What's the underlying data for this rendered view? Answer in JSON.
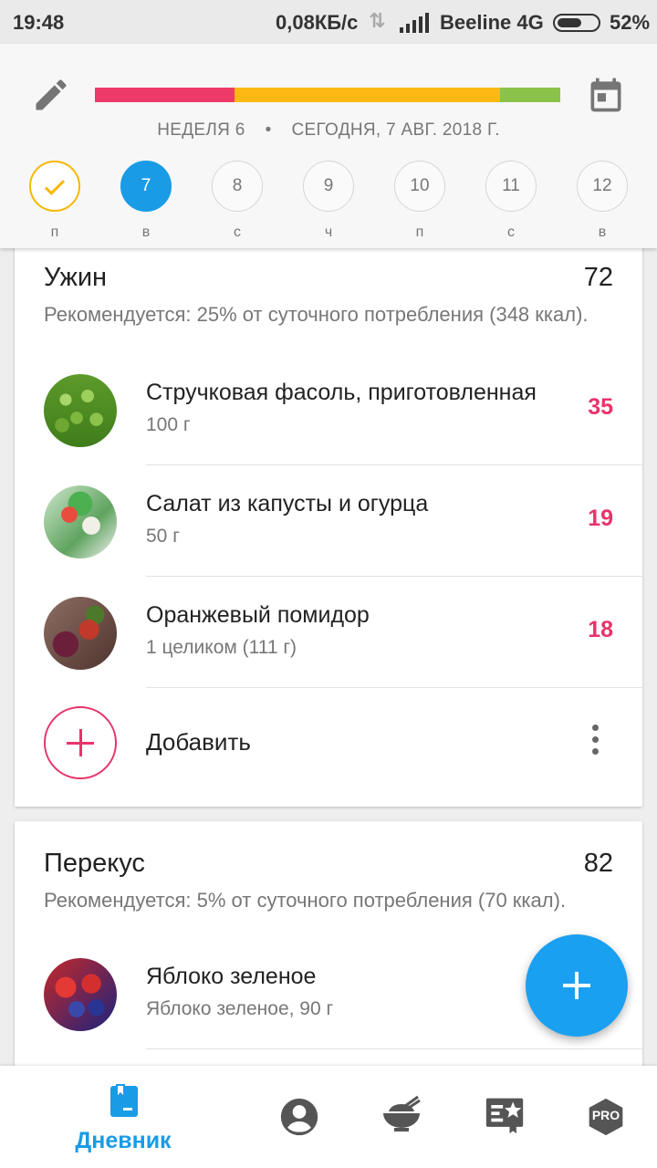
{
  "status_bar": {
    "time": "19:48",
    "speed": "0,08КБ/с",
    "carrier": "Beeline 4G",
    "battery": "52%"
  },
  "header": {
    "week": "НЕДЕЛЯ 6",
    "separator": "•",
    "date": "СЕГОДНЯ, 7 АВГ. 2018 Г.",
    "progress_segments": [
      {
        "fraction": 0.3,
        "color": "#ee3a68"
      },
      {
        "fraction": 0.57,
        "color": "#fdb813"
      },
      {
        "fraction": 0.13,
        "color": "#8bc34a"
      }
    ],
    "days": [
      {
        "num": "",
        "label": "п",
        "state": "done"
      },
      {
        "num": "7",
        "label": "в",
        "state": "today"
      },
      {
        "num": "8",
        "label": "с",
        "state": ""
      },
      {
        "num": "9",
        "label": "ч",
        "state": ""
      },
      {
        "num": "10",
        "label": "п",
        "state": ""
      },
      {
        "num": "11",
        "label": "с",
        "state": ""
      },
      {
        "num": "12",
        "label": "в",
        "state": ""
      }
    ]
  },
  "dinner": {
    "title": "Ужин",
    "total": "72",
    "recommendation": "Рекомендуется: 25% от суточного потребления (348 ккал).",
    "items": [
      {
        "name": "Стручковая фасоль, приготовленная",
        "portion": "100 г",
        "kcal": "35",
        "icon": "peas-photo"
      },
      {
        "name": "Салат из капусты и огурца",
        "portion": "50 г",
        "kcal": "19",
        "icon": "salad-photo"
      },
      {
        "name": "Оранжевый помидор",
        "portion": "1 целиком (111 г)",
        "kcal": "18",
        "icon": "vegetables-photo"
      }
    ],
    "add_label": "Добавить"
  },
  "snack": {
    "title": "Перекус",
    "total": "82",
    "recommendation": "Рекомендуется: 5% от суточного потребления (70 ккал).",
    "items": [
      {
        "name": "Яблоко зеленое",
        "portion": "Яблоко зеленое, 90 г",
        "kcal": "",
        "icon": "berries-photo"
      }
    ]
  },
  "bottom_nav": {
    "diary_label": "Дневник",
    "pro_label": "PRO",
    "accent": "#1a9be6"
  }
}
